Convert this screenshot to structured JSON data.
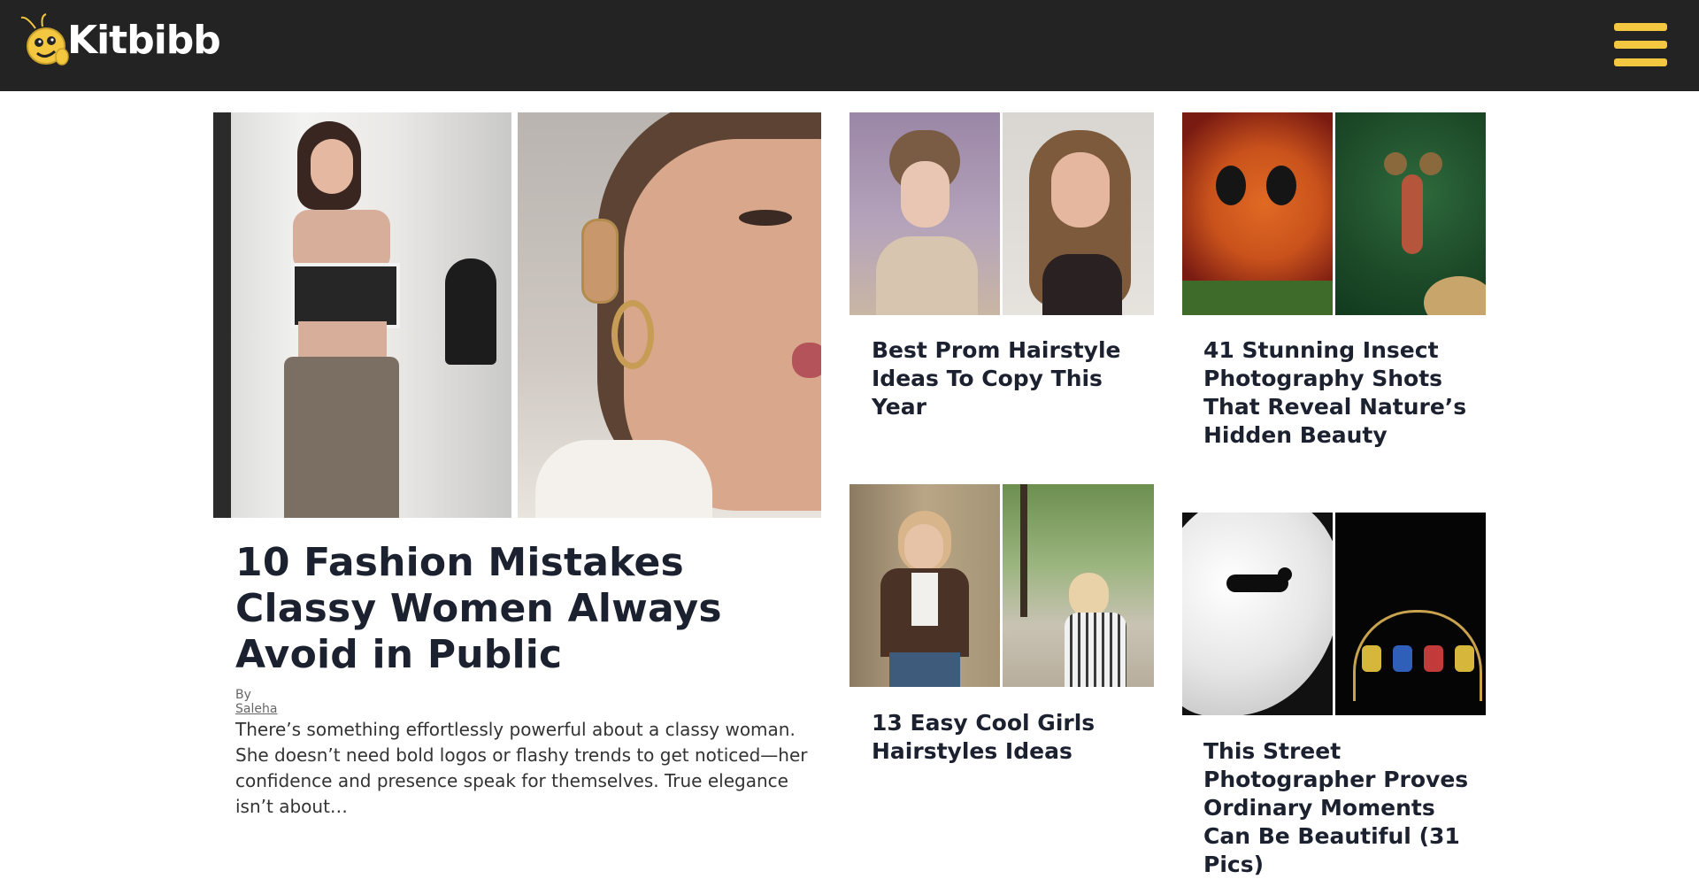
{
  "header": {
    "logo_text": "Kitbibb",
    "logo_icon": "bee-icon",
    "menu_icon": "hamburger-menu-icon",
    "accent_color": "#f3c73f",
    "background_color": "#232323"
  },
  "featured": {
    "title": "10 Fashion Mistakes Classy Women Always Avoid in Public",
    "by_label": "By",
    "author": "Saleha",
    "excerpt": "There’s something effortlessly powerful about a classy woman. She doesn’t need bold logos or flashy trends to get noticed—her confidence and presence speak for themselves. True elegance isn’t about…"
  },
  "articles": [
    {
      "title": "Best Prom Hairstyle Ideas To Copy This Year"
    },
    {
      "title": "41 Stunning Insect Photography Shots That Reveal Nature’s Hidden Beauty"
    },
    {
      "title": "13 Easy Cool Girls Hairstyles Ideas"
    },
    {
      "title": "This Street Photographer Proves Ordinary Moments Can Be Beautiful (31 Pics)"
    }
  ]
}
